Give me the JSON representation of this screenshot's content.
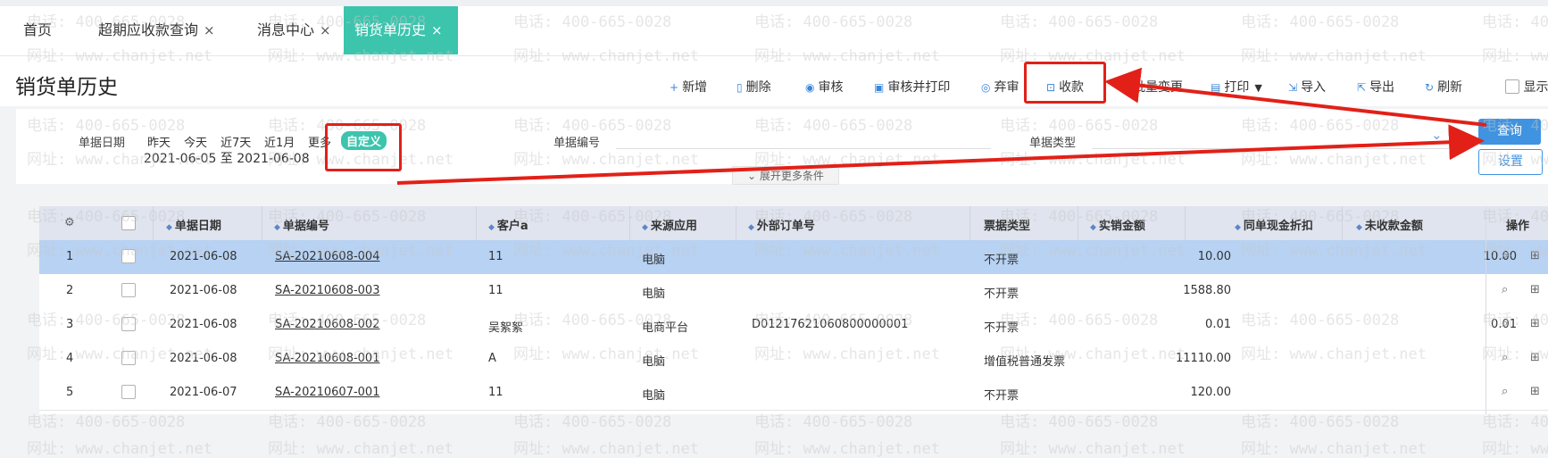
{
  "tabs": [
    {
      "label": "首页",
      "close": ""
    },
    {
      "label": "超期应收款查询",
      "close": "×"
    },
    {
      "label": "消息中心",
      "close": "×"
    },
    {
      "label": "销货单历史",
      "close": "×"
    }
  ],
  "page_title": "销货单历史",
  "toolbar": {
    "new": "新增",
    "delete": "删除",
    "audit": "审核",
    "audit_print": "审核并打印",
    "abandon": "弃审",
    "collect": "收款",
    "batch": "批量变更",
    "print": "打印",
    "import": "导入",
    "export": "导出",
    "refresh": "刷新",
    "show": "显示"
  },
  "filter": {
    "date_label": "单据日期",
    "quick": [
      "昨天",
      "今天",
      "近7天",
      "近1月",
      "更多"
    ],
    "custom": "自定义",
    "range": "2021-06-05 至 2021-06-08",
    "docno_label": "单据编号",
    "doctype_label": "单据类型",
    "expand": "展开更多条件",
    "query": "查询",
    "settings": "设置"
  },
  "table": {
    "headers": [
      "单据日期",
      "单据编号",
      "客户a",
      "来源应用",
      "外部订单号",
      "票据类型",
      "实销金额",
      "同单现金折扣",
      "未收款金额",
      "操作"
    ],
    "rows": [
      {
        "no": "1",
        "date": "2021-06-08",
        "doc": "SA-20210608-004",
        "cust": "11",
        "src": "电脑",
        "ext": "",
        "type": "不开票",
        "amt": "10.00",
        "disc": "",
        "unpaid": "10.00"
      },
      {
        "no": "2",
        "date": "2021-06-08",
        "doc": "SA-20210608-003",
        "cust": "11",
        "src": "电脑",
        "ext": "",
        "type": "不开票",
        "amt": "1588.80",
        "disc": "",
        "unpaid": ""
      },
      {
        "no": "3",
        "date": "2021-06-08",
        "doc": "SA-20210608-002",
        "cust": "吴絮絮",
        "src": "电商平台",
        "ext": "D01217621060800000001",
        "type": "不开票",
        "amt": "0.01",
        "disc": "",
        "unpaid": "0.01"
      },
      {
        "no": "4",
        "date": "2021-06-08",
        "doc": "SA-20210608-001",
        "cust": "A",
        "src": "电脑",
        "ext": "",
        "type": "增值税普通发票",
        "amt": "11110.00",
        "disc": "",
        "unpaid": ""
      },
      {
        "no": "5",
        "date": "2021-06-07",
        "doc": "SA-20210607-001",
        "cust": "11",
        "src": "电脑",
        "ext": "",
        "type": "不开票",
        "amt": "120.00",
        "disc": "",
        "unpaid": ""
      }
    ]
  },
  "watermark": {
    "phone": "电话: 400-665-0028",
    "site": "网址: www.chanjet.net"
  },
  "colors": {
    "accent": "#3cc4ad",
    "primary": "#3a86d8",
    "selected_row": "#b7d2f3",
    "annotation": "#e22018"
  },
  "icons": [
    "plus-icon",
    "trash-icon",
    "audit-icon",
    "audit-print-icon",
    "abandon-icon",
    "collect-icon",
    "batch-icon",
    "print-icon",
    "import-icon",
    "export-icon",
    "refresh-icon",
    "gear-icon",
    "view-doc-icon",
    "more-grid-icon",
    "chevron-down-icon"
  ]
}
